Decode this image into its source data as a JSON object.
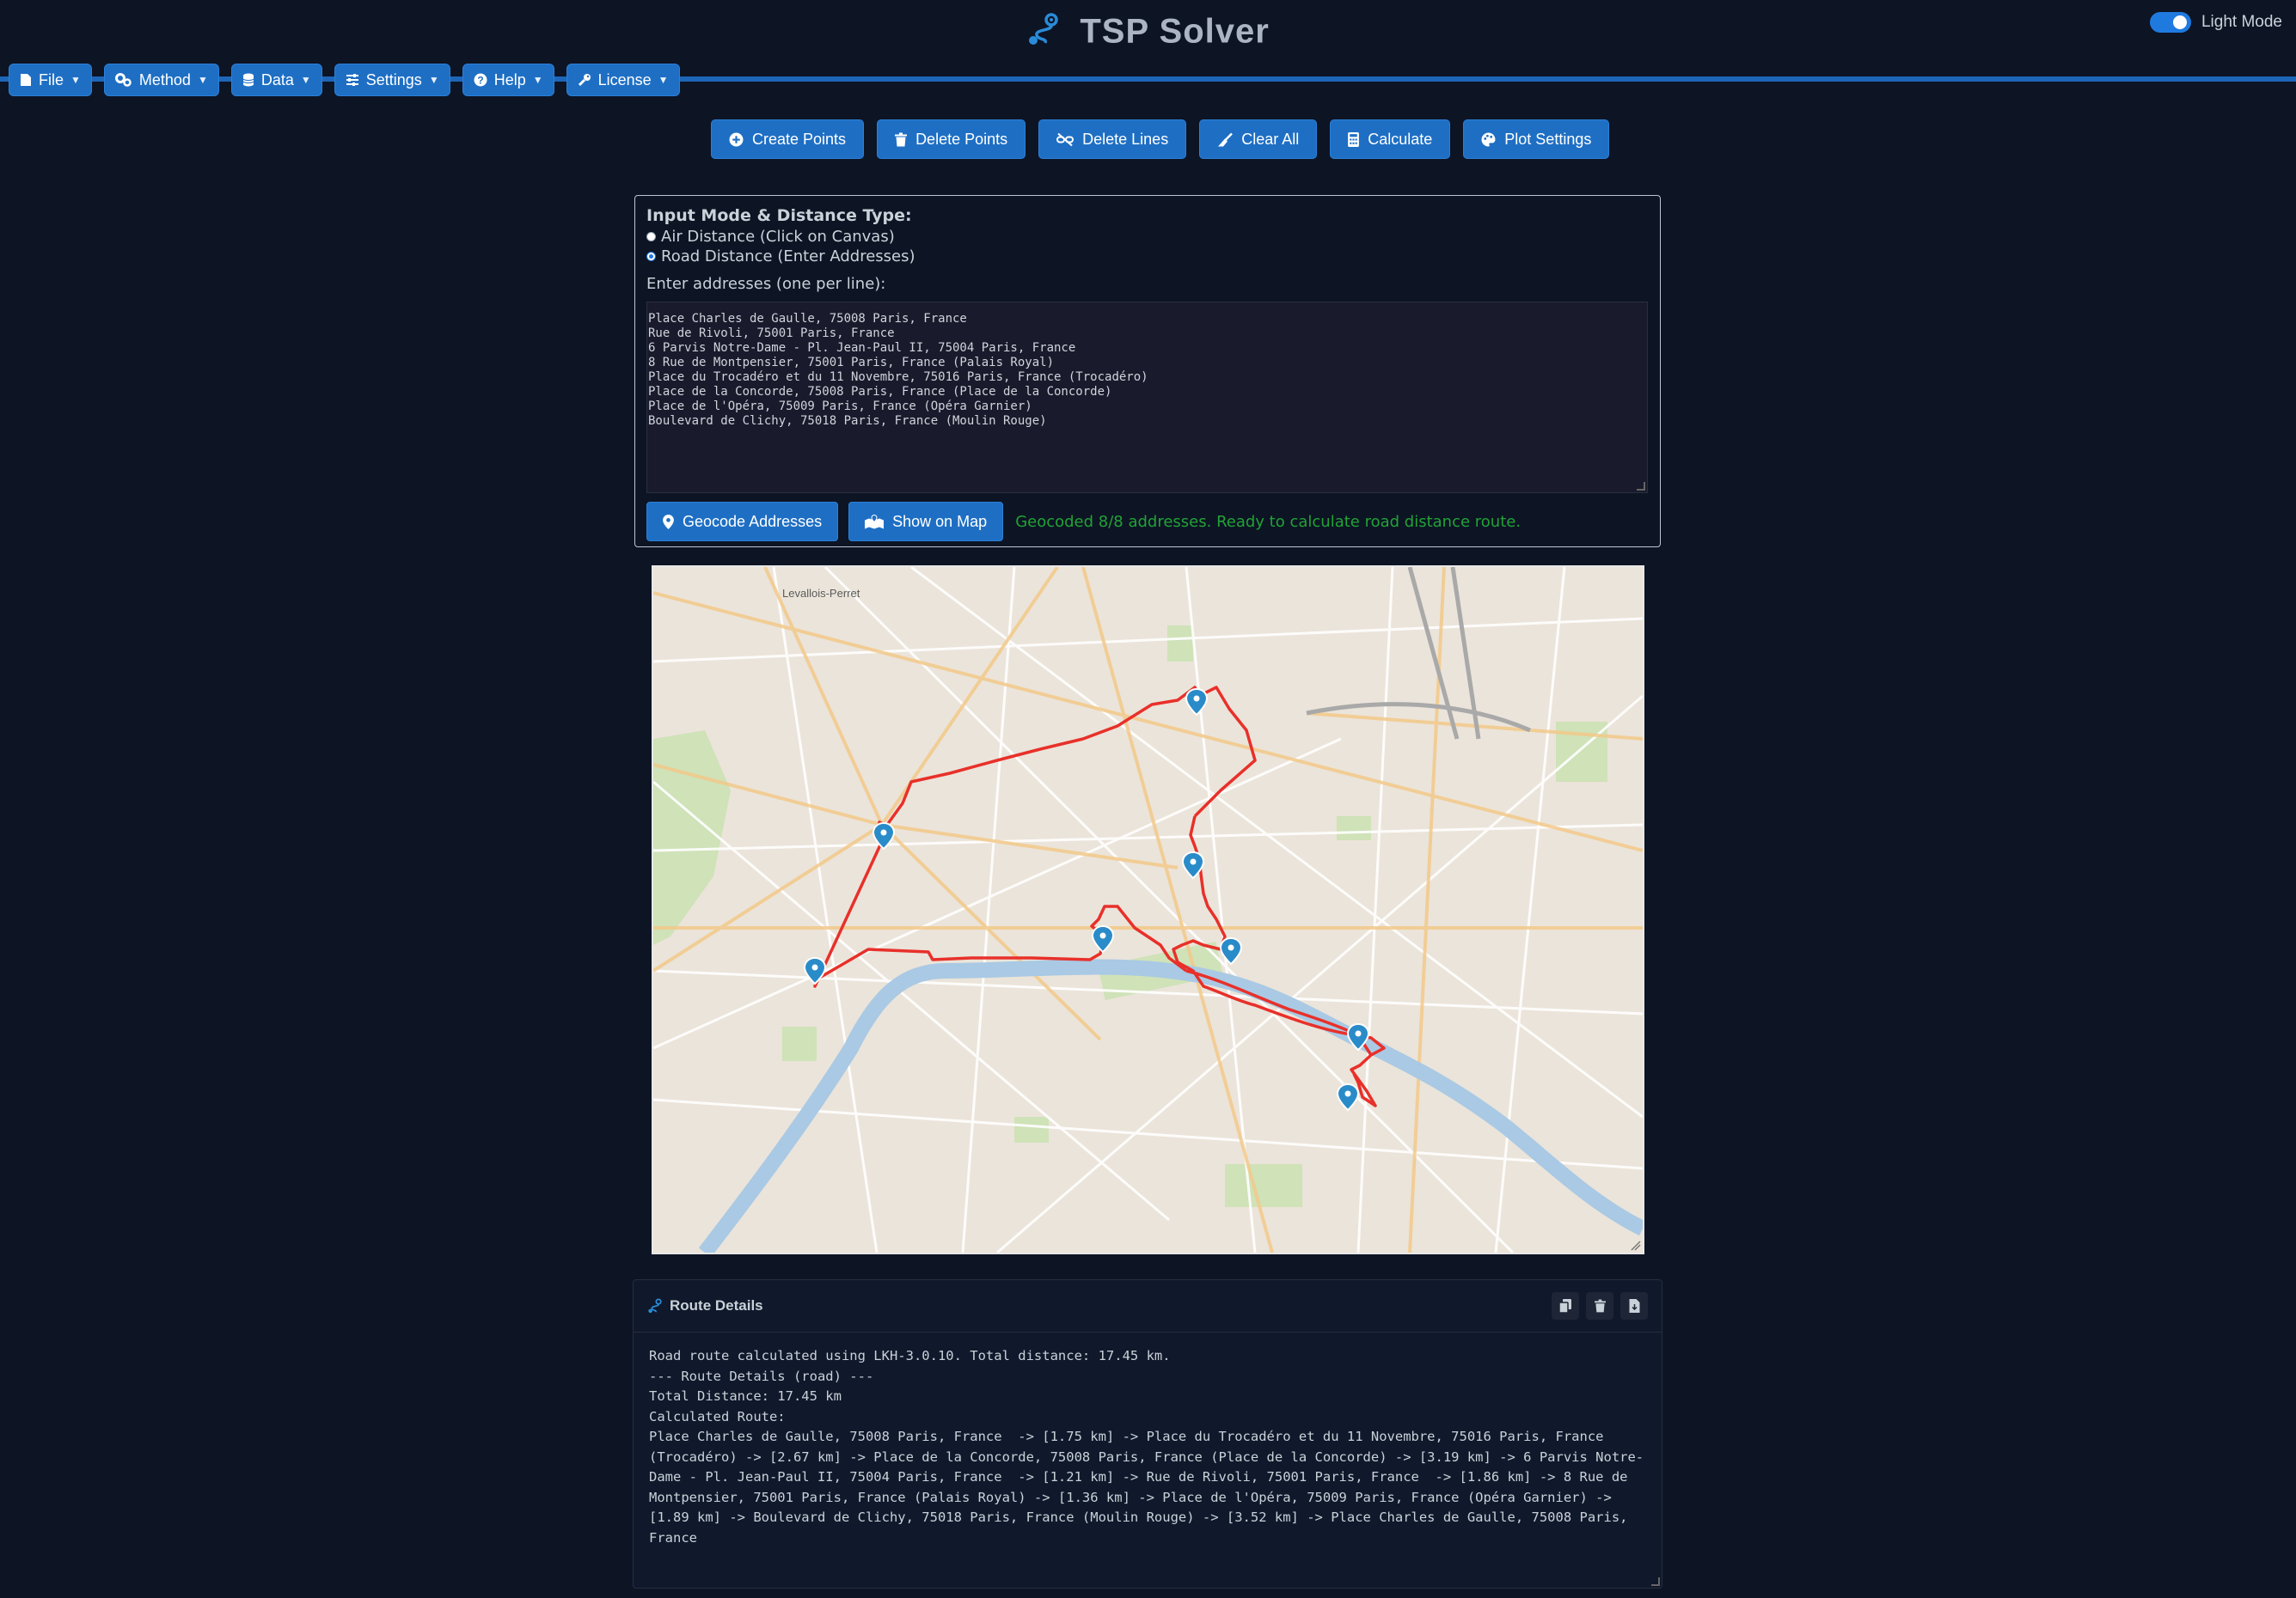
{
  "app": {
    "title": "TSP Solver",
    "theme_toggle_label": "Light Mode"
  },
  "menubar": {
    "items": [
      {
        "label": "File",
        "icon": "file-icon"
      },
      {
        "label": "Method",
        "icon": "gears-icon"
      },
      {
        "label": "Data",
        "icon": "database-icon"
      },
      {
        "label": "Settings",
        "icon": "sliders-icon"
      },
      {
        "label": "Help",
        "icon": "question-icon"
      },
      {
        "label": "License",
        "icon": "key-icon"
      }
    ]
  },
  "toolbar": {
    "create_points": "Create Points",
    "delete_points": "Delete Points",
    "delete_lines": "Delete Lines",
    "clear_all": "Clear All",
    "calculate": "Calculate",
    "plot_settings": "Plot Settings"
  },
  "input": {
    "heading": "Input Mode & Distance Type:",
    "air_option": "Air Distance (Click on Canvas)",
    "road_option": "Road Distance (Enter Addresses)",
    "selected": "road",
    "addresses_label": "Enter addresses (one per line):",
    "addresses": [
      "Place Charles de Gaulle, 75008 Paris, France",
      "Rue de Rivoli, 75001 Paris, France",
      "6 Parvis Notre-Dame - Pl. Jean-Paul II, 75004 Paris, France",
      "8 Rue de Montpensier, 75001 Paris, France (Palais Royal)",
      "Place du Trocadéro et du 11 Novembre, 75016 Paris, France (Trocadéro)",
      "Place de la Concorde, 75008 Paris, France (Place de la Concorde)",
      "Place de l'Opéra, 75009 Paris, France (Opéra Garnier)",
      "Boulevard de Clichy, 75018 Paris, France (Moulin Rouge)"
    ],
    "geocode_button": "Geocode Addresses",
    "show_map_button": "Show on Map",
    "status": "Geocoded 8/8 addresses. Ready to calculate road distance route."
  },
  "map": {
    "labels": [
      "Levallois-Perret"
    ],
    "colors": {
      "route": "#e8302a",
      "marker": "#2a8bc9",
      "river": "#a7c8e3",
      "park": "#c9dfb3"
    }
  },
  "route_details": {
    "title": "Route Details",
    "lines": [
      "Road route calculated using LKH-3.0.10. Total distance: 17.45 km.",
      "--- Route Details (road) ---",
      "Total Distance: 17.45 km",
      "Calculated Route:",
      "Place Charles de Gaulle, 75008 Paris, France  -> [1.75 km] -> Place du Trocadéro et du 11 Novembre, 75016 Paris, France (Trocadéro) -> [2.67 km] -> Place de la Concorde, 75008 Paris, France (Place de la Concorde) -> [3.19 km] -> 6 Parvis Notre-Dame - Pl. Jean-Paul II, 75004 Paris, France  -> [1.21 km] -> Rue de Rivoli, 75001 Paris, France  -> [1.86 km] -> 8 Rue de Montpensier, 75001 Paris, France (Palais Royal) -> [1.36 km] -> Place de l'Opéra, 75009 Paris, France (Opéra Garnier) -> [1.89 km] -> Boulevard de Clichy, 75018 Paris, France (Moulin Rouge) -> [3.52 km] -> Place Charles de Gaulle, 75008 Paris, France"
    ]
  }
}
